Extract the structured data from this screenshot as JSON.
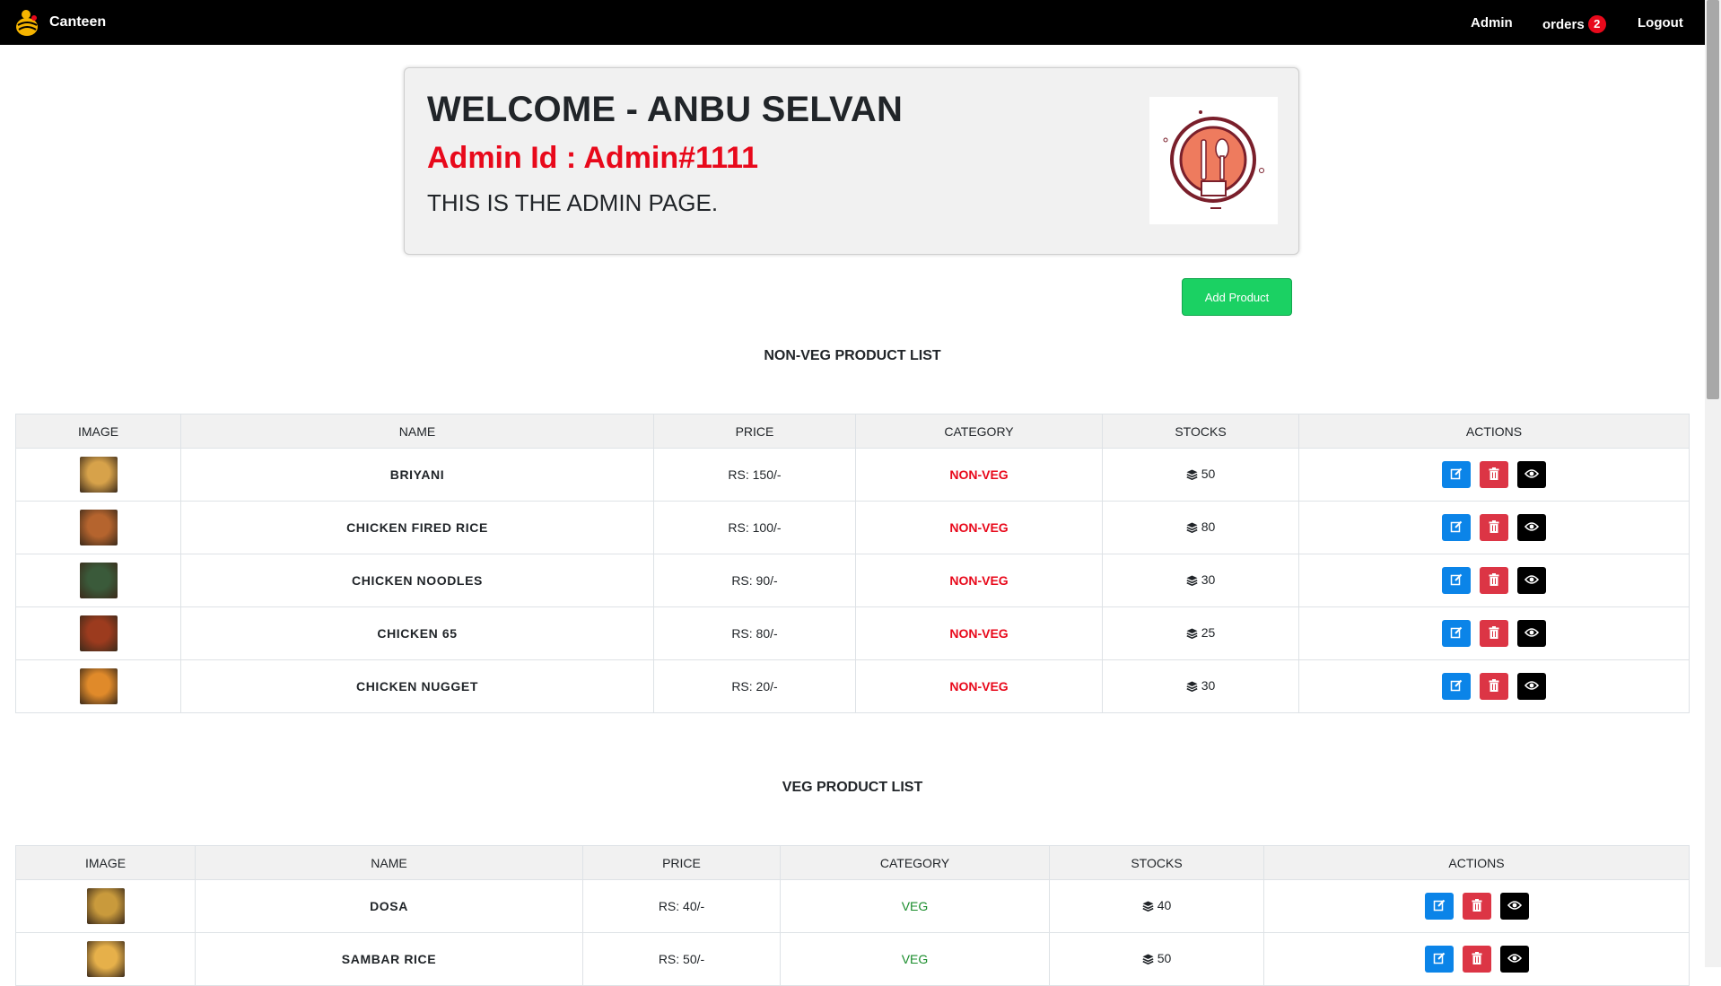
{
  "nav": {
    "brand": "Canteen",
    "admin": "Admin",
    "orders": "orders",
    "orders_count": "2",
    "logout": "Logout"
  },
  "welcome": {
    "title": "WELCOME - ANBU SELVAN",
    "admin_id": "Admin Id : Admin#1111",
    "subtitle": "THIS IS THE ADMIN PAGE."
  },
  "add_button": "Add Product",
  "columns": [
    "IMAGE",
    "NAME",
    "PRICE",
    "CATEGORY",
    "STOCKS",
    "ACTIONS"
  ],
  "nonveg": {
    "title": "NON-VEG PRODUCT LIST",
    "rows": [
      {
        "name": "BRIYANI",
        "price": "RS: 150/-",
        "category": "NON-VEG",
        "stock": "50"
      },
      {
        "name": "CHICKEN FIRED RICE",
        "price": "RS: 100/-",
        "category": "NON-VEG",
        "stock": "80"
      },
      {
        "name": "CHICKEN NOODLES",
        "price": "RS: 90/-",
        "category": "NON-VEG",
        "stock": "30"
      },
      {
        "name": "CHICKEN 65",
        "price": "RS: 80/-",
        "category": "NON-VEG",
        "stock": "25"
      },
      {
        "name": "CHICKEN NUGGET",
        "price": "RS: 20/-",
        "category": "NON-VEG",
        "stock": "30"
      }
    ]
  },
  "veg": {
    "title": "VEG PRODUCT LIST",
    "rows": [
      {
        "name": "DOSA",
        "price": "RS: 40/-",
        "category": "VEG",
        "stock": "40"
      },
      {
        "name": "SAMBAR RICE",
        "price": "RS: 50/-",
        "category": "VEG",
        "stock": "50"
      }
    ]
  },
  "colors": {
    "navbar": "#000000",
    "accent_red": "#e8091b",
    "add_green": "#1bd163",
    "edit_blue": "#0b84e8",
    "delete_red": "#dc3545",
    "veg_green": "#1a8d2c"
  },
  "icons": {
    "edit": "edit-icon",
    "delete": "trash-icon",
    "view": "eye-icon",
    "stock": "layers-icon"
  }
}
